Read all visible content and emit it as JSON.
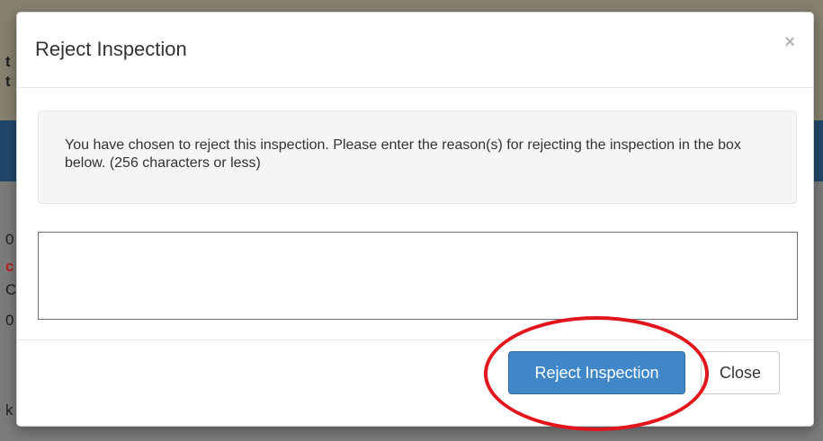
{
  "background": {
    "fragments": [
      "t",
      "t",
      "0",
      "c",
      "C",
      "0",
      "k"
    ]
  },
  "modal": {
    "title": "Reject Inspection",
    "close_symbol": "×",
    "message": "You have chosen to reject this inspection. Please enter the reason(s) for rejecting the inspection in the box below. (256 characters or less)",
    "reason_value": "",
    "reason_placeholder": "",
    "reject_label": "Reject Inspection",
    "close_label": "Close"
  },
  "colors": {
    "primary_button": "#3f87c7",
    "highlight_ring": "#e2151c",
    "nav_band": "#20476a"
  },
  "icons": {
    "close": "close-icon"
  }
}
